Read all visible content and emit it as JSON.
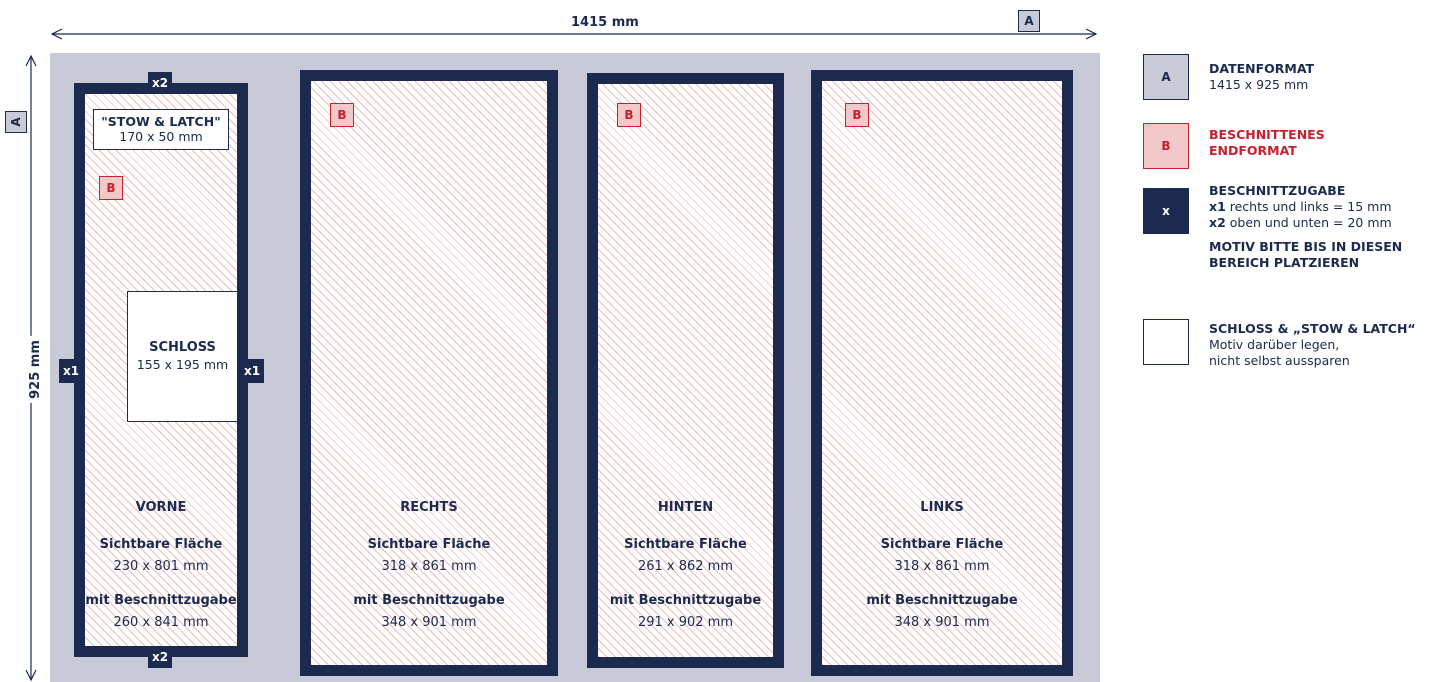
{
  "dimensions": {
    "width_label": "1415 mm",
    "height_label": "925 mm",
    "tag": "A"
  },
  "panels": [
    {
      "name": "VORNE",
      "visible_label": "Sichtbare Fläche",
      "visible_size": "230 x 801 mm",
      "bleed_label": "mit Beschnittzugabe",
      "bleed_size": "260 x 841 mm",
      "tag": "B"
    },
    {
      "name": "RECHTS",
      "visible_label": "Sichtbare Fläche",
      "visible_size": "318 x 861 mm",
      "bleed_label": "mit Beschnittzugabe",
      "bleed_size": "348 x 901 mm",
      "tag": "B"
    },
    {
      "name": "HINTEN",
      "visible_label": "Sichtbare Fläche",
      "visible_size": "261 x 862 mm",
      "bleed_label": "mit Beschnittzugabe",
      "bleed_size": "291 x 902 mm",
      "tag": "B"
    },
    {
      "name": "LINKS",
      "visible_label": "Sichtbare Fläche",
      "visible_size": "318 x 861 mm",
      "bleed_label": "mit Beschnittzugabe",
      "bleed_size": "348 x 901 mm",
      "tag": "B"
    }
  ],
  "bleed_markers": {
    "top": "x2",
    "bottom": "x2",
    "left": "x1",
    "right": "x1"
  },
  "stow_latch": {
    "title": "\"STOW & LATCH\"",
    "size": "170 x 50 mm"
  },
  "schloss": {
    "title": "SCHLOSS",
    "size": "155 x 195 mm"
  },
  "legend": {
    "a": {
      "tag": "A",
      "title": "DATENFORMAT",
      "value": "1415 x 925 mm"
    },
    "b": {
      "tag": "B",
      "title_line1": "BESCHNITTENES",
      "title_line2": "ENDFORMAT"
    },
    "x": {
      "tag": "x",
      "title": "BESCHNITTZUGABE",
      "x1_key": "x1",
      "x1_text": "rechts und links = 15 mm",
      "x2_key": "x2",
      "x2_text": "oben und unten = 20 mm",
      "note_line1": "MOTIV BITTE BIS IN DIESEN",
      "note_line2": "BEREICH PLATZIEREN"
    },
    "white": {
      "title": "SCHLOSS & „STOW & LATCH“",
      "line1": "Motiv darüber legen,",
      "line2": "nicht selbst aussparen"
    }
  },
  "colors": {
    "navy": "#1b2a4e",
    "sheet": "#c8cad8",
    "red": "#c8202f",
    "pink": "#f2c9c9"
  }
}
